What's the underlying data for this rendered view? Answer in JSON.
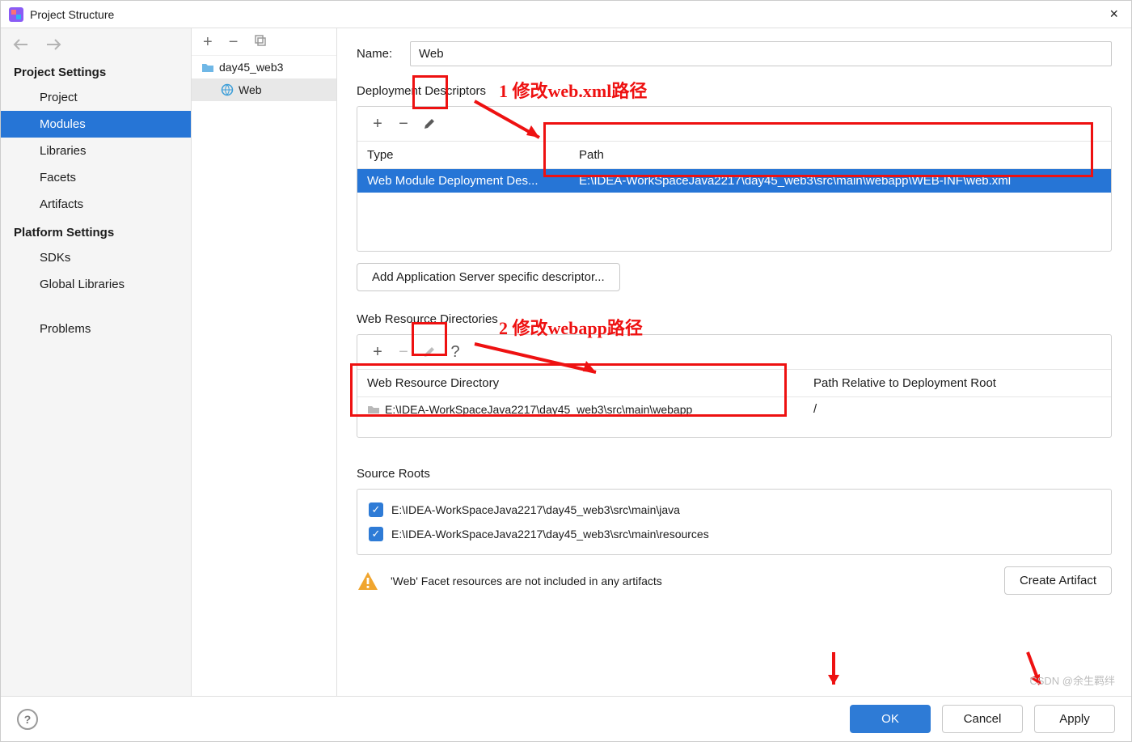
{
  "window": {
    "title": "Project Structure"
  },
  "sidebar": {
    "sections": [
      {
        "title": "Project Settings",
        "items": [
          "Project",
          "Modules",
          "Libraries",
          "Facets",
          "Artifacts"
        ]
      },
      {
        "title": "Platform Settings",
        "items": [
          "SDKs",
          "Global Libraries"
        ]
      }
    ],
    "problems": "Problems",
    "selected": "Modules"
  },
  "tree": {
    "module": "day45_web3",
    "facet": "Web"
  },
  "form": {
    "name_label": "Name:",
    "name_value": "Web",
    "dd": {
      "title": "Deployment Descriptors",
      "col1": "Type",
      "col2": "Path",
      "row_type": "Web Module Deployment Des...",
      "row_path": "E:\\IDEA-WorkSpaceJava2217\\day45_web3\\src\\main\\webapp\\WEB-INF\\web.xml",
      "add_btn": "Add Application Server specific descriptor..."
    },
    "wrd": {
      "title": "Web Resource Directories",
      "col1": "Web Resource Directory",
      "col2": "Path Relative to Deployment Root",
      "row_dir": "E:\\IDEA-WorkSpaceJava2217\\day45_web3\\src\\main\\webapp",
      "row_rel": "/"
    },
    "sr": {
      "title": "Source Roots",
      "r1": "E:\\IDEA-WorkSpaceJava2217\\day45_web3\\src\\main\\java",
      "r2": "E:\\IDEA-WorkSpaceJava2217\\day45_web3\\src\\main\\resources"
    },
    "warning": "'Web' Facet resources are not included in any artifacts",
    "create_artifact": "Create Artifact"
  },
  "footer": {
    "ok": "OK",
    "cancel": "Cancel",
    "apply": "Apply"
  },
  "annotations": {
    "a1": "1  修改web.xml路径",
    "a2": "2  修改webapp路径"
  },
  "watermark": "CSDN @余生羁绊"
}
